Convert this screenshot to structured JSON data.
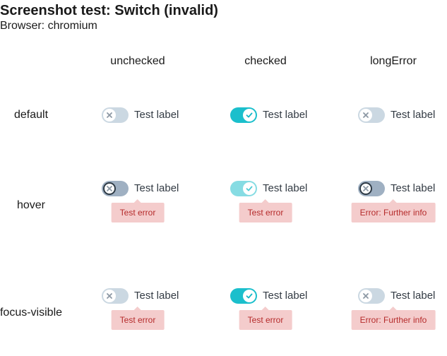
{
  "page": {
    "title": "Screenshot test: Switch (invalid)",
    "browser": "Browser: chromium"
  },
  "columns": [
    "unchecked",
    "checked",
    "longError"
  ],
  "rows": [
    "default",
    "hover",
    "focus-visible"
  ],
  "switch_label": "Test label",
  "errors": {
    "short": "Test error",
    "long": "Error: Further info"
  },
  "colors": {
    "track_off": "#cbd8e2",
    "track_on": "#1bbfcc",
    "error_bg": "#f4cccc",
    "error_text": "#b52b2b"
  }
}
